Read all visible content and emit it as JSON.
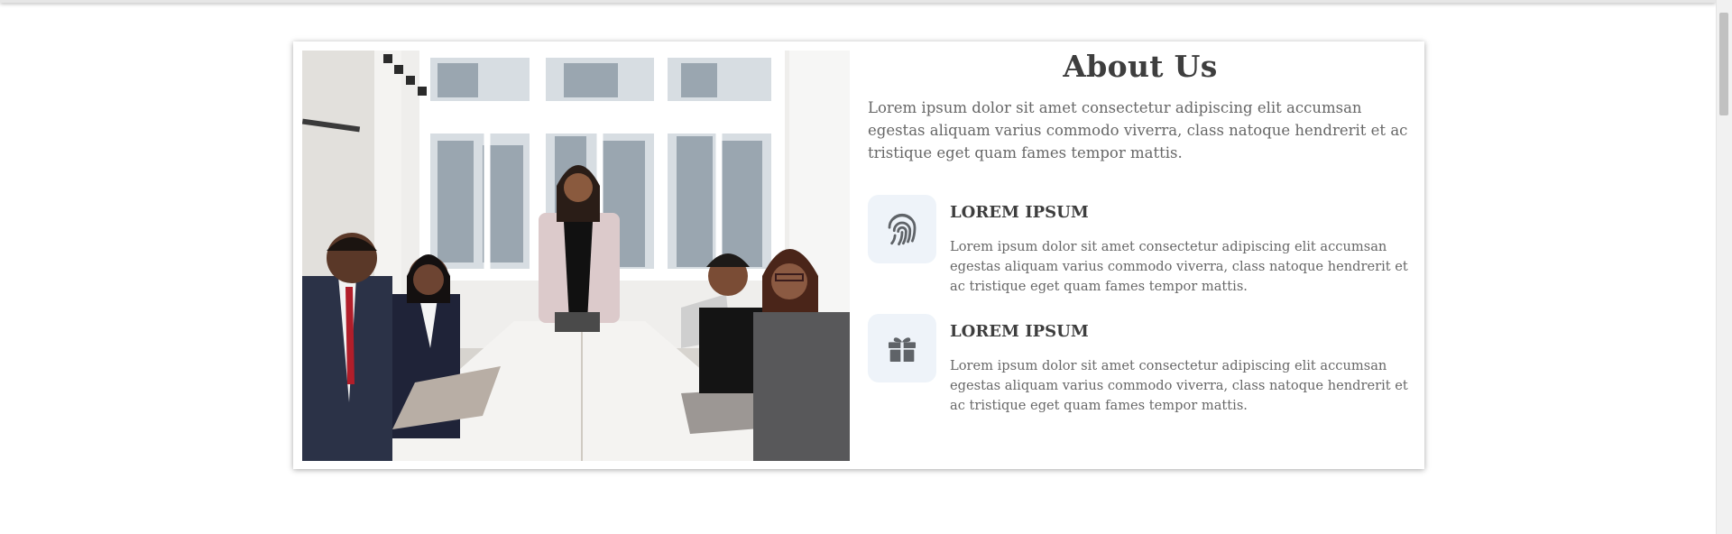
{
  "about": {
    "title": "About Us",
    "intro": "Lorem ipsum dolor sit amet consectetur adipiscing elit accumsan egestas aliquam varius commodo viverra, class natoque hendrerit et ac tristique eget quam fames tempor mattis."
  },
  "features": [
    {
      "icon": "fingerprint-icon",
      "title": "LOREM IPSUM",
      "text": "Lorem ipsum dolor sit amet consectetur adipiscing elit accumsan egestas aliquam varius commodo viverra, class natoque hendrerit et ac tristique eget quam fames tempor mattis."
    },
    {
      "icon": "gift-icon",
      "title": "LOREM IPSUM",
      "text": "Lorem ipsum dolor sit amet consectetur adipiscing elit accumsan egestas aliquam varius commodo viverra, class natoque hendrerit et ac tristique eget quam fames tempor mattis."
    }
  ],
  "colors": {
    "heading": "#3e3e3e",
    "body_text": "#676767",
    "icon_tile": "#eef3f9",
    "icon": "#5f6368"
  }
}
